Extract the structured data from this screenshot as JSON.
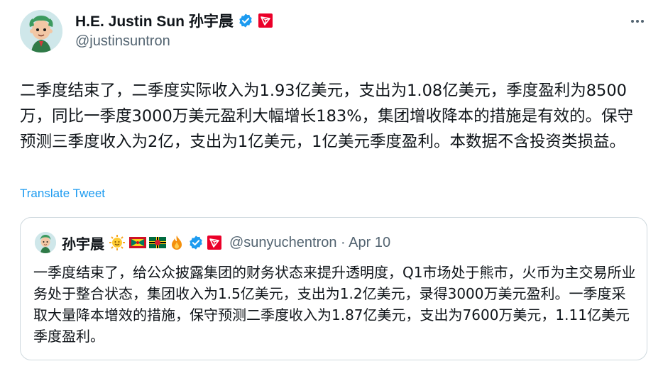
{
  "author": {
    "name": "H.E. Justin Sun 孙宇晨",
    "handle": "@justinsuntron",
    "badges": [
      "verified-icon",
      "tron-logo-icon"
    ]
  },
  "tweet": {
    "text": "二季度结束了，二季度实际收入为1.93亿美元，支出为1.08亿美元，季度盈利为8500万，同比一季度3000万美元盈利大幅增长183%，集团增收降本的措施是有效的。保守预测三季度收入为2亿，支出为1亿美元，1亿美元季度盈利。本数据不含投资类损益。",
    "translate_label": "Translate Tweet"
  },
  "quoted": {
    "name": "孙宇晨",
    "emojis": [
      "sun-face-icon",
      "grenada-flag-icon",
      "dominica-flag-icon",
      "fire-icon"
    ],
    "badges": [
      "verified-icon",
      "tron-logo-icon"
    ],
    "meta": "@sunyuchentron · Apr 10",
    "text": "一季度结束了，给公众披露集团的财务状态来提升透明度，Q1市场处于熊市，火币为主交易所业务处于整合状态，集团收入为1.5亿美元，支出为1.2亿美元，录得3000万美元盈利。一季度采取大量降本增效的措施，保守预测二季度收入为1.87亿美元，支出为7600万美元，1.11亿美元季度盈利。"
  },
  "colors": {
    "text": "#0f1419",
    "secondary": "#536471",
    "link": "#1d9bf0",
    "verified": "#1d9bf0",
    "tron": "#eb0029",
    "border": "#cfd9de"
  }
}
